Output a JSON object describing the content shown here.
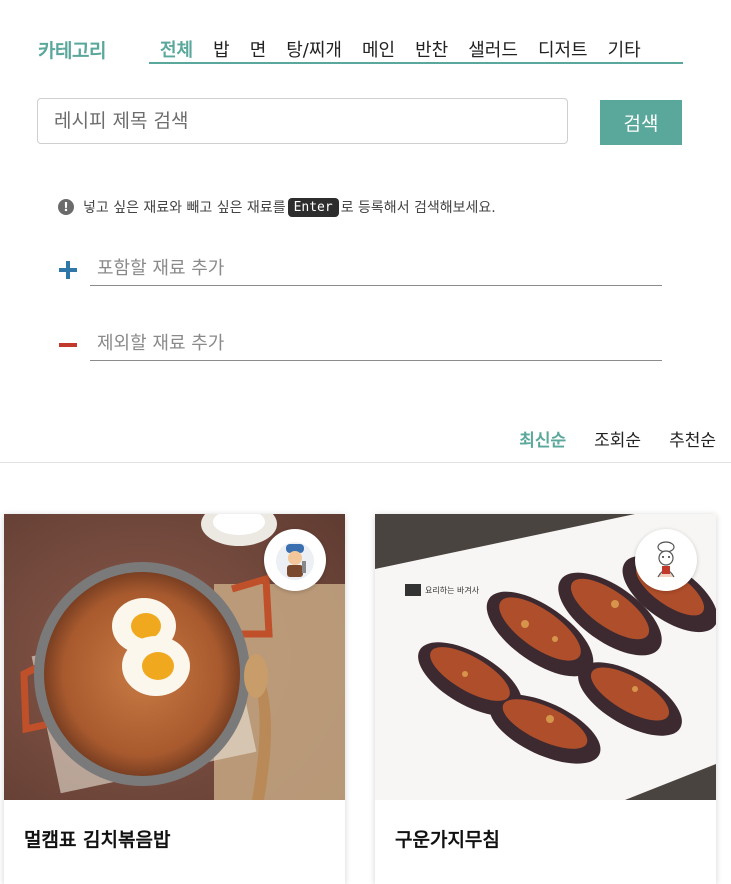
{
  "category": {
    "title": "카테고리",
    "tabs": [
      {
        "label": "전체",
        "active": true
      },
      {
        "label": "밥"
      },
      {
        "label": "면"
      },
      {
        "label": "탕/찌개"
      },
      {
        "label": "메인"
      },
      {
        "label": "반찬"
      },
      {
        "label": "샐러드"
      },
      {
        "label": "디저트"
      },
      {
        "label": "기타"
      }
    ]
  },
  "search": {
    "placeholder": "레시피 제목 검색",
    "button": "검색"
  },
  "help": {
    "before": "넣고 싶은 재료와 빼고 싶은 재료를",
    "key": "Enter",
    "after": "로 등록해서 검색해보세요."
  },
  "ingredients": {
    "include_placeholder": "포함할 재료 추가",
    "exclude_placeholder": "제외할 재료 추가"
  },
  "sort": {
    "options": [
      "최신순",
      "조회순",
      "추천순"
    ],
    "active": "최신순"
  },
  "recipes": [
    {
      "title": "멀캠표 김치볶음밥"
    },
    {
      "title": "구운가지무침",
      "watermark": "요리하는 바겨사"
    }
  ],
  "colors": {
    "accent": "#5aa89b",
    "plus": "#2f77a8",
    "minus": "#c0392b"
  }
}
